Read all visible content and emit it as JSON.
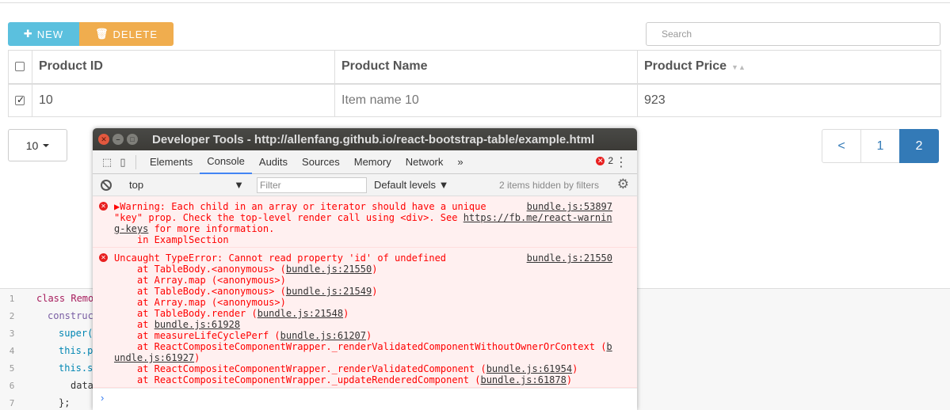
{
  "toolbar": {
    "new_label": "NEW",
    "delete_label": "DELETE"
  },
  "search": {
    "placeholder": "Search"
  },
  "table": {
    "headers": [
      "Product ID",
      "Product Name",
      "Product Price"
    ],
    "rows": [
      {
        "id": "10",
        "name": "Item name 10",
        "price": "923",
        "checked": true
      }
    ]
  },
  "pager": {
    "size": "10",
    "pages": [
      "<",
      "1",
      "2"
    ],
    "active": "2"
  },
  "code": {
    "lines": [
      {
        "n": "1",
        "text": "class Remo"
      },
      {
        "n": "2",
        "text": "construc"
      },
      {
        "n": "3",
        "text": "super("
      },
      {
        "n": "4",
        "text": "this.p"
      },
      {
        "n": "5",
        "text": "this.s"
      },
      {
        "n": "6",
        "text": "data"
      },
      {
        "n": "7",
        "text": "};"
      }
    ]
  },
  "devtools": {
    "title": "Developer Tools - http://allenfang.github.io/react-bootstrap-table/example.html",
    "tabs": [
      "Elements",
      "Console",
      "Audits",
      "Sources",
      "Memory",
      "Network"
    ],
    "active_tab": "Console",
    "more": "»",
    "error_count": "2",
    "context": "top",
    "filter_placeholder": "Filter",
    "levels": "Default levels",
    "hidden_info": "2 items hidden by filters",
    "warning": {
      "location": "bundle.js:53897",
      "l1": "Warning: Each child in an array or iterator should have a unique",
      "l2a": "\"key\" prop. Check the top-level render call using <div>. See ",
      "l2link": "https://fb.me/react-warnin",
      "l3link": "g-keys",
      "l3b": " for more information.",
      "l4": "in ExamplSection"
    },
    "error": {
      "location": "bundle.js:21550",
      "title": "Uncaught TypeError: Cannot read property 'id' of undefined",
      "s1a": "at TableBody.<anonymous> (",
      "s1b": "bundle.js:21550",
      "s1c": ")",
      "s2": "at Array.map (<anonymous>)",
      "s3a": "at TableBody.<anonymous> (",
      "s3b": "bundle.js:21549",
      "s3c": ")",
      "s4": "at Array.map (<anonymous>)",
      "s5a": "at TableBody.render (",
      "s5b": "bundle.js:21548",
      "s5c": ")",
      "s6a": "at ",
      "s6b": "bundle.js:61928",
      "s7a": "at measureLifeCyclePerf (",
      "s7b": "bundle.js:61207",
      "s7c": ")",
      "s8a": "at ReactCompositeComponentWrapper._renderValidatedComponentWithoutOwnerOrContext (",
      "s8b": "b",
      "s9a": "undle.js:61927",
      "s9b": ")",
      "s10a": "at ReactCompositeComponentWrapper._renderValidatedComponent (",
      "s10b": "bundle.js:61954",
      "s10c": ")",
      "s11a": "at ReactCompositeComponentWrapper._updateRenderedComponent (",
      "s11b": "bundle.js:61878",
      "s11c": ")"
    },
    "prompt": "›"
  }
}
